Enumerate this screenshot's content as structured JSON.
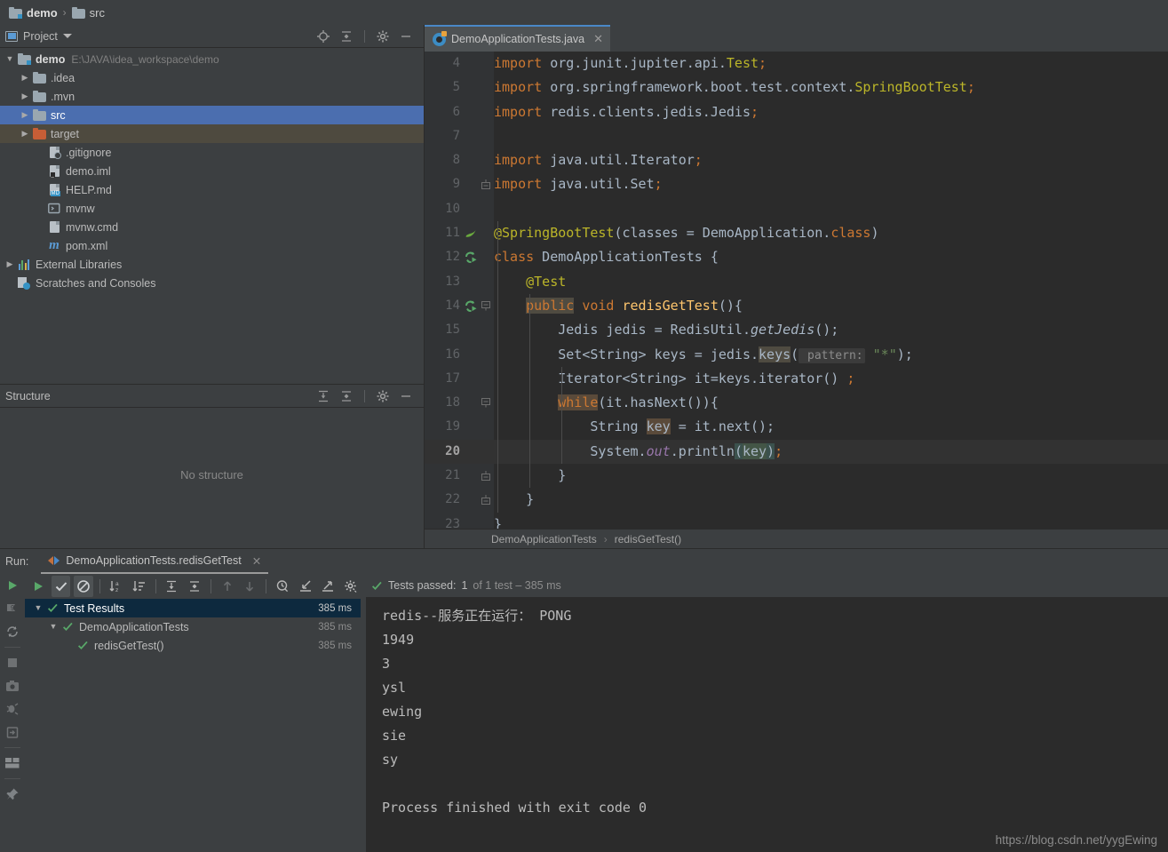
{
  "breadcrumb_top": {
    "items": [
      {
        "label": "demo",
        "icon": "folder-module-icon",
        "bold": true
      },
      {
        "label": "src",
        "icon": "folder-icon",
        "bold": false
      }
    ],
    "separator": "›"
  },
  "project_panel": {
    "title": "Project",
    "dropdown_icon": "chevron-down-icon",
    "header_icons": [
      "locate-icon",
      "collapse-all-icon",
      "gear-icon",
      "minimize-icon"
    ],
    "tree": [
      {
        "label": "demo",
        "path": "E:\\JAVA\\idea_workspace\\demo",
        "icon": "folder-module-icon",
        "arrow": "open",
        "depth": 0,
        "bold": true,
        "state": "normal"
      },
      {
        "label": ".idea",
        "icon": "folder-icon",
        "arrow": "closed",
        "depth": 1,
        "state": "normal"
      },
      {
        "label": ".mvn",
        "icon": "folder-icon",
        "arrow": "closed",
        "depth": 1,
        "state": "normal"
      },
      {
        "label": "src",
        "icon": "folder-icon",
        "arrow": "closed",
        "depth": 1,
        "state": "selected"
      },
      {
        "label": "target",
        "icon": "folder-orange-icon",
        "arrow": "closed",
        "depth": 1,
        "state": "highlighted"
      },
      {
        "label": ".gitignore",
        "icon": "gitignore-file-icon",
        "arrow": "none",
        "depth": 2,
        "state": "normal"
      },
      {
        "label": "demo.iml",
        "icon": "iml-file-icon",
        "arrow": "none",
        "depth": 2,
        "state": "normal"
      },
      {
        "label": "HELP.md",
        "icon": "markdown-file-icon",
        "arrow": "none",
        "depth": 2,
        "state": "normal"
      },
      {
        "label": "mvnw",
        "icon": "shell-file-icon",
        "arrow": "none",
        "depth": 2,
        "state": "normal"
      },
      {
        "label": "mvnw.cmd",
        "icon": "cmd-file-icon",
        "arrow": "none",
        "depth": 2,
        "state": "normal"
      },
      {
        "label": "pom.xml",
        "icon": "maven-file-icon",
        "arrow": "none",
        "depth": 2,
        "state": "normal"
      },
      {
        "label": "External Libraries",
        "icon": "libraries-icon",
        "arrow": "closed",
        "depth": 0,
        "state": "normal"
      },
      {
        "label": "Scratches and Consoles",
        "icon": "scratches-icon",
        "arrow": "none",
        "depth": 0,
        "state": "normal"
      }
    ]
  },
  "structure_panel": {
    "title": "Structure",
    "header_icons": [
      "expand-all-icon",
      "collapse-all-icon",
      "gear-icon",
      "minimize-icon"
    ],
    "empty_text": "No structure"
  },
  "editor": {
    "tab": {
      "label": "DemoApplicationTests.java",
      "icon": "java-class-icon",
      "close_icon": "close-icon"
    },
    "first_line_number": 4,
    "current_line": 20,
    "lines": [
      {
        "n": 4,
        "gutter_icon": null,
        "fold": null,
        "html": "<span class=\"kw\">import</span> org.junit.jupiter.api.<span class=\"anno\">Test</span><span class=\"kw\">;</span>",
        "text": "import org.junit.jupiter.api.Test;"
      },
      {
        "n": 5,
        "gutter_icon": null,
        "fold": null,
        "html": "<span class=\"kw\">import</span> org.springframework.boot.test.context.<span class=\"anno\">SpringBootTest</span><span class=\"kw\">;</span>",
        "text": "import org.springframework.boot.test.context.SpringBootTest;"
      },
      {
        "n": 6,
        "gutter_icon": null,
        "fold": null,
        "html": "<span class=\"kw\">import</span> redis.clients.jedis.Jedis<span class=\"kw\">;</span>",
        "text": "import redis.clients.jedis.Jedis;"
      },
      {
        "n": 7,
        "gutter_icon": null,
        "fold": null,
        "html": "",
        "text": ""
      },
      {
        "n": 8,
        "gutter_icon": null,
        "fold": null,
        "html": "<span class=\"kw\">import</span> java.util.Iterator<span class=\"kw\">;</span>",
        "text": "import java.util.Iterator;"
      },
      {
        "n": 9,
        "gutter_icon": null,
        "fold": "end",
        "html": "<span class=\"kw\">import</span> java.util.Set<span class=\"kw\">;</span>",
        "text": "import java.util.Set;"
      },
      {
        "n": 10,
        "gutter_icon": null,
        "fold": null,
        "html": "",
        "text": ""
      },
      {
        "n": 11,
        "gutter_icon": "spring-leaf-icon",
        "fold": null,
        "html": "<span class=\"anno\">@SpringBootTest</span>(classes = DemoApplication.<span class=\"kw\">class</span>)",
        "text": "@SpringBootTest(classes = DemoApplication.class)"
      },
      {
        "n": 12,
        "gutter_icon": "run-test-icon",
        "fold": null,
        "html": "<span class=\"kw\">class</span> DemoApplicationTests {",
        "text": "class DemoApplicationTests {"
      },
      {
        "n": 13,
        "gutter_icon": null,
        "fold": null,
        "html": "    <span class=\"anno\">@Test</span>",
        "text": "    @Test"
      },
      {
        "n": 14,
        "gutter_icon": "run-test-icon",
        "fold": "start",
        "html": "    <span class=\"kw hl-ident\">public</span> <span class=\"kw\">void</span> <span class=\"mth\">redisGetTest</span>(){",
        "text": "    public void redisGetTest(){"
      },
      {
        "n": 15,
        "gutter_icon": null,
        "fold": null,
        "html": "        Jedis jedis = RedisUtil.<span class=\"sta\">getJedis</span>();",
        "text": "        Jedis jedis = RedisUtil.getJedis();"
      },
      {
        "n": 16,
        "gutter_icon": null,
        "fold": null,
        "html": "        Set&lt;String&gt; keys = jedis.<span class=\"hl-ident\">keys</span>(<span class=\"hint\"> pattern:</span> <span class=\"str\">\"*\"</span>);",
        "text": "        Set<String> keys = jedis.keys( pattern: \"*\");"
      },
      {
        "n": 17,
        "gutter_icon": null,
        "fold": null,
        "html": "        Iterator&lt;String&gt; it=keys.iterator() <span class=\"kw\">;</span>",
        "text": "        Iterator<String> it=keys.iterator() ;"
      },
      {
        "n": 18,
        "gutter_icon": null,
        "fold": "start",
        "html": "        <span class=\"kw hl-word\">while</span>(it.hasNext()){",
        "text": "        while(it.hasNext()){"
      },
      {
        "n": 19,
        "gutter_icon": null,
        "fold": null,
        "html": "            String <span class=\"hl-word\">key</span> = it.next();",
        "text": "            String key = it.next();"
      },
      {
        "n": 20,
        "gutter_icon": null,
        "fold": null,
        "html": "            System.<span class=\"fld\">out</span>.println<span class=\"hl-brace\">(</span><span class=\"hl-dim\">key</span><span class=\"hl-brace\">)</span><span class=\"kw\">;</span>",
        "text": "            System.out.println(key);"
      },
      {
        "n": 21,
        "gutter_icon": null,
        "fold": "end",
        "html": "        }",
        "text": "        }"
      },
      {
        "n": 22,
        "gutter_icon": null,
        "fold": "end",
        "html": "    }",
        "text": "    }"
      },
      {
        "n": 23,
        "gutter_icon": null,
        "fold": null,
        "html": "}",
        "text": "}"
      }
    ],
    "breadcrumbs": [
      "DemoApplicationTests",
      "redisGetTest()"
    ],
    "breadcrumb_separator": "›"
  },
  "run_panel": {
    "run_label": "Run:",
    "tab_label": "DemoApplicationTests.redisGetTest",
    "tab_close_icon": "close-icon",
    "left_rail_icons": [
      "run-icon",
      "rerun-failed-icon",
      "rerun-auto-icon",
      "stop-icon",
      "screenshot-icon",
      "debug-icon",
      "export-icon",
      "layout-icon",
      "pin-icon"
    ],
    "toolbar_icons": [
      "rerun-icon",
      "show-passed-icon",
      "show-ignored-icon",
      "sort-alphabetically-icon",
      "sort-duration-icon",
      "expand-all-icon",
      "collapse-all-icon",
      "prev-icon",
      "next-icon",
      "history-icon",
      "import-icon",
      "export-icon",
      "settings-icon"
    ],
    "status": {
      "icon": "check-icon",
      "prefix": "Tests passed:",
      "count": "1",
      "suffix": "of 1 test – 385 ms"
    },
    "tree": [
      {
        "label": "Test Results",
        "time": "385 ms",
        "depth": 0,
        "arrow": "open",
        "state": "selected"
      },
      {
        "label": "DemoApplicationTests",
        "time": "385 ms",
        "depth": 1,
        "arrow": "open",
        "state": "normal"
      },
      {
        "label": "redisGetTest()",
        "time": "385 ms",
        "depth": 2,
        "arrow": "none",
        "state": "normal"
      }
    ],
    "console_lines": [
      "redis--服务正在运行： PONG",
      "1949",
      "3",
      "ysl",
      "ewing",
      "sie",
      "sy",
      "",
      "Process finished with exit code 0"
    ]
  },
  "watermark": "https://blog.csdn.net/yygEwing",
  "colors": {
    "bg_panel": "#3c3f41",
    "bg_editor": "#2b2b2b",
    "selection_blue": "#4b6eaf",
    "accent_blue": "#4a88c7",
    "keyword_orange": "#cc7832",
    "string_green": "#6a8759",
    "annotation_yellow": "#bbb529",
    "method_yellow": "#ffc66d",
    "success_green": "#59a869",
    "text": "#bbbbbb"
  }
}
